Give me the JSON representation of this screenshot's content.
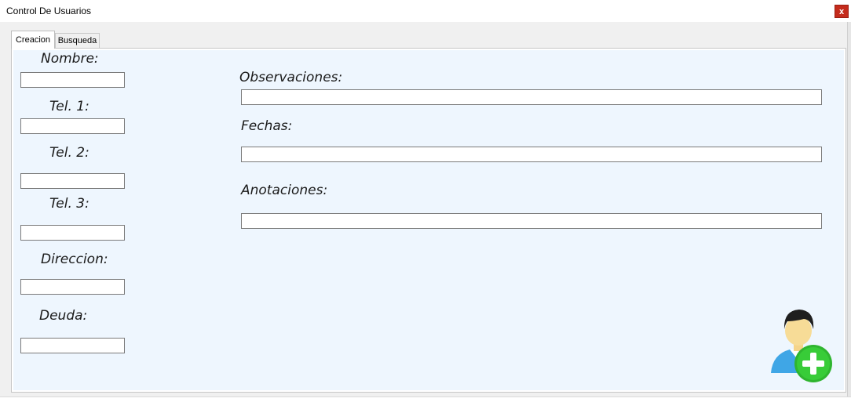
{
  "window": {
    "title": "Control De Usuarios",
    "close_label": "x"
  },
  "tabs": [
    {
      "label": "Creacion",
      "active": true
    },
    {
      "label": "Busqueda",
      "active": false
    }
  ],
  "form": {
    "nombre_label": "Nombre:",
    "tel1_label": "Tel. 1:",
    "tel2_label": "Tel. 2:",
    "tel3_label": "Tel. 3:",
    "direccion_label": "Direccion:",
    "deuda_label": "Deuda:",
    "observaciones_label": "Observaciones:",
    "fechas_label": "Fechas:",
    "anotaciones_label": "Anotaciones:",
    "values": {
      "nombre": "",
      "tel1": "",
      "tel2": "",
      "tel3": "",
      "direccion": "",
      "deuda": "",
      "observaciones": "",
      "fechas": "",
      "anotaciones": ""
    }
  },
  "colors": {
    "panel_background": "#eef6fe",
    "close_button": "#c42b1c",
    "add_icon_green": "#33cc33",
    "user_shirt_blue": "#3fa6e6"
  },
  "icons": {
    "add_user": "add-user-icon"
  }
}
